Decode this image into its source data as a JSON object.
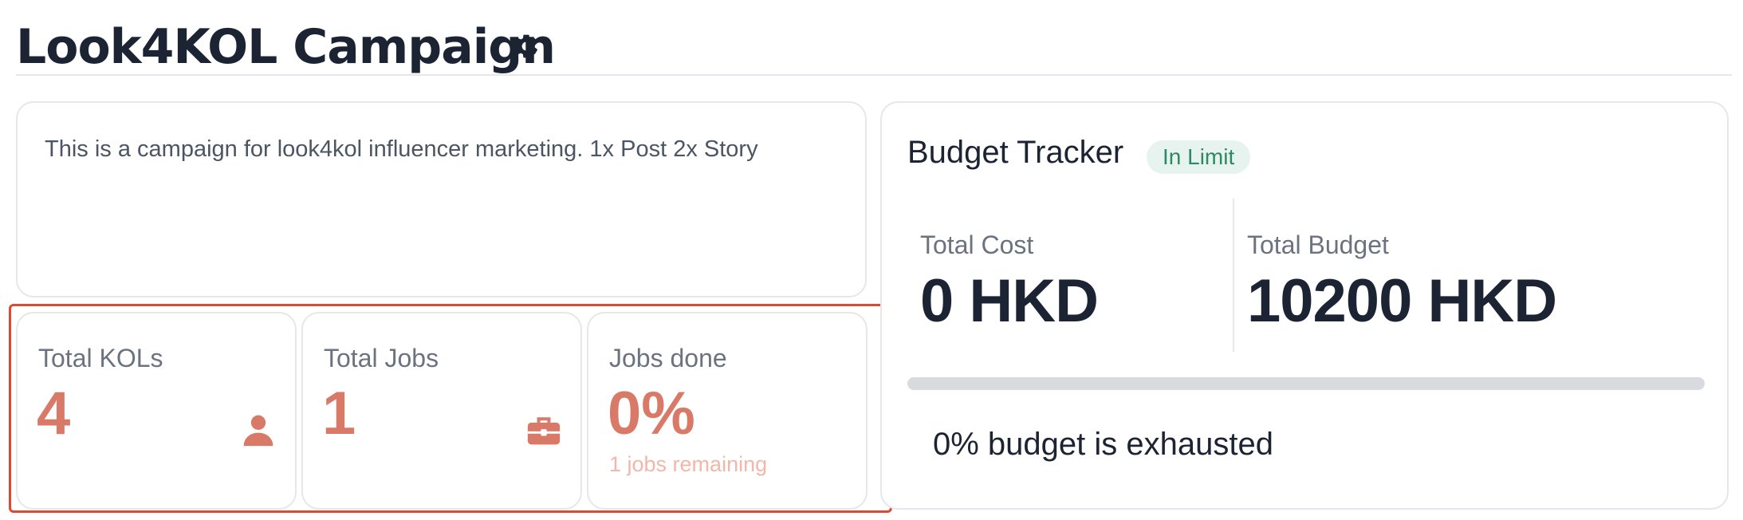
{
  "header": {
    "title": "Look4KOL Campaign",
    "settings_icon": "gear-icon"
  },
  "campaign": {
    "description": "This is a campaign for look4kol influencer marketing. 1x Post 2x Story"
  },
  "stats": [
    {
      "label": "Total KOLs",
      "value": "4",
      "icon": "user-icon"
    },
    {
      "label": "Total Jobs",
      "value": "1",
      "icon": "briefcase-icon"
    },
    {
      "label": "Jobs done",
      "value": "0%",
      "sub": "1 jobs remaining"
    }
  ],
  "budget": {
    "title": "Budget Tracker",
    "status_badge": "In Limit",
    "total_cost_label": "Total Cost",
    "total_cost_value": "0 HKD",
    "total_budget_label": "Total Budget",
    "total_budget_value": "10200 HKD",
    "exhausted_fraction": 0,
    "exhausted_text": "0% budget is exhausted"
  },
  "colors": {
    "accent": "#d97a68",
    "accent_light": "#f2b7a8",
    "highlight_border": "#dc4a2f",
    "badge_bg": "#e7f3ee",
    "badge_text": "#2e8a63",
    "title_text": "#1c2434"
  }
}
